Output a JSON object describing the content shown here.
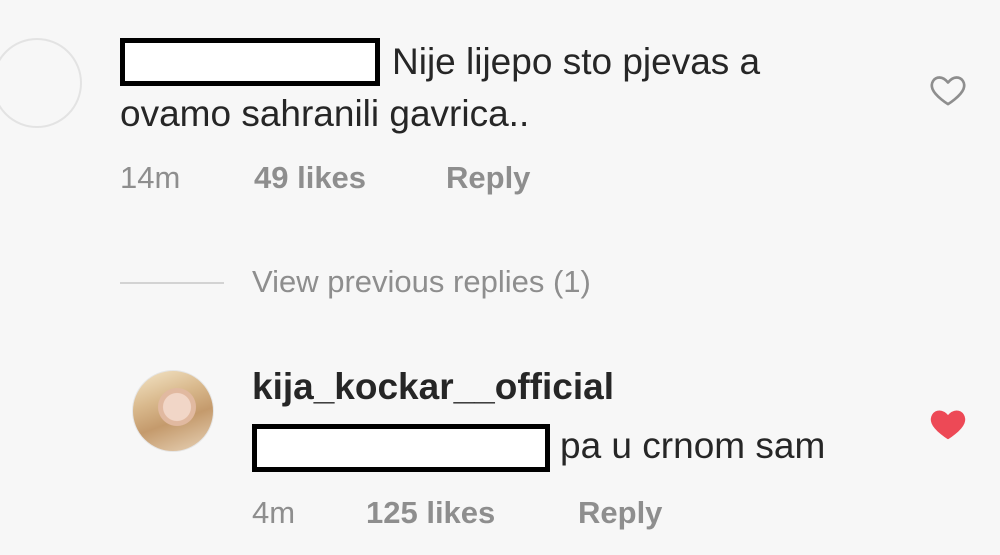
{
  "comments": [
    {
      "text_line1": "Nije lijepo sto pjevas a",
      "text_line2": "ovamo sahranili gavrica..",
      "time": "14m",
      "likes": "49 likes",
      "reply_label": "Reply",
      "liked": false
    },
    {
      "username": "kija_kockar__official",
      "text": "pa u crnom sam",
      "time": "4m",
      "likes": "125 likes",
      "reply_label": "Reply",
      "liked": true
    }
  ],
  "view_previous_replies": "View previous replies (1)",
  "colors": {
    "text": "#262626",
    "muted": "#8e8e8e",
    "heart_liked": "#ed4956",
    "heart_outline": "#8e8e8e",
    "background": "#f7f7f7"
  },
  "icons": {
    "like_outline": "heart-outline-icon",
    "like_filled": "heart-filled-icon"
  }
}
